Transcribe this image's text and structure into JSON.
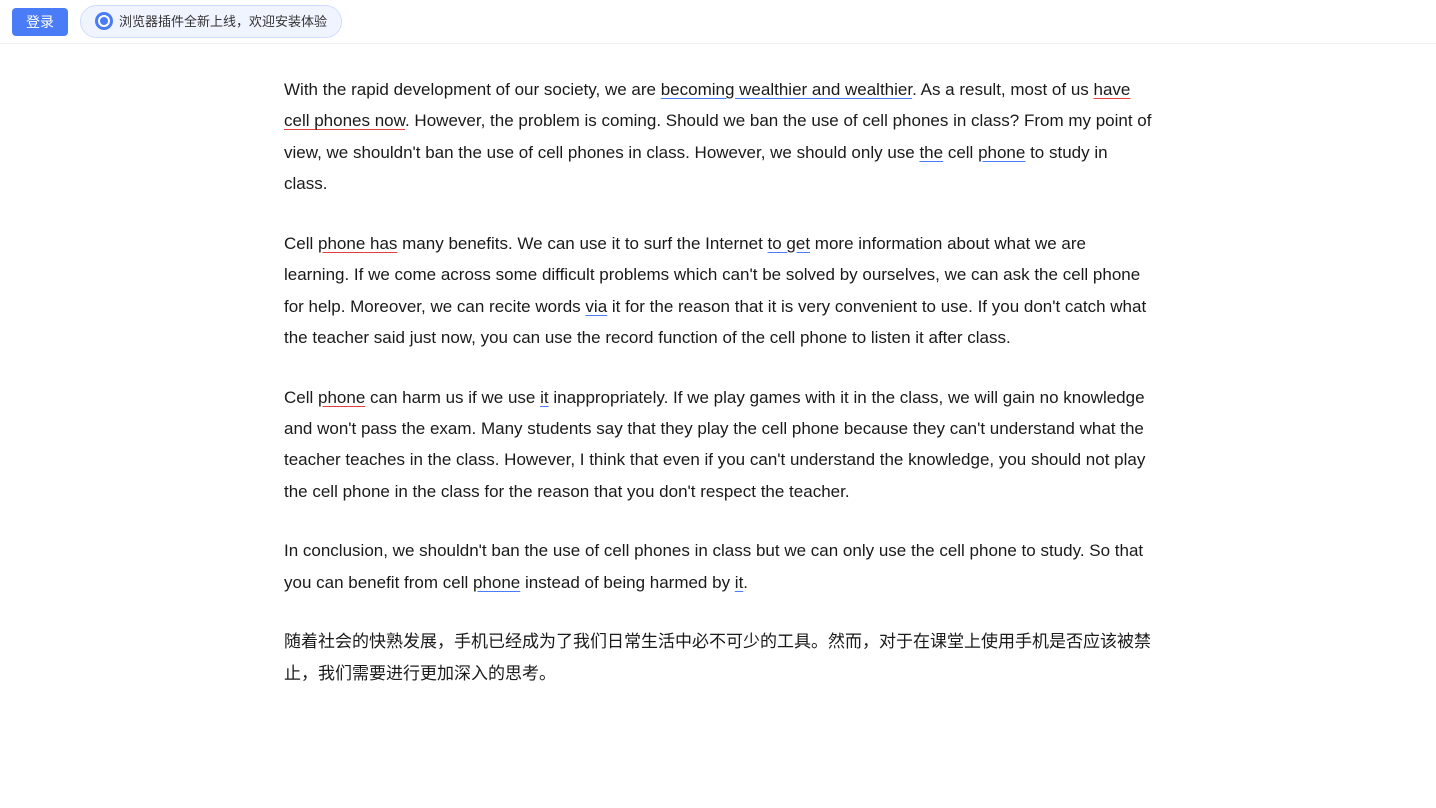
{
  "topbar": {
    "login_label": "登录",
    "banner_text": "浏览器插件全新上线，欢迎安装体验"
  },
  "article": {
    "paragraphs": [
      {
        "id": "p1",
        "text": "With the rapid development of our society, we are becoming wealthier and wealthier. As a result, most of us have cell phones now. However, the problem is coming. Should we ban the use of cell phones in class? From my point of view, we shouldn't ban the use of cell phones in class. However, we should only use the cell phone to study in class."
      },
      {
        "id": "p2",
        "text": "Cell phone has many benefits. We can use it to surf the Internet to get more information about what we are learning. If we come across some difficult problems which can't be solved by ourselves, we can ask the cell phone for help. Moreover, we can recite words via it for the reason that it is very convenient to use. If you don't catch what the teacher said just now, you can use the record function of the cell phone to listen it after class."
      },
      {
        "id": "p3",
        "text": "Cell phone can harm us if we use it inappropriately. If we play games with it in the class, we will gain no knowledge and won't pass the exam. Many students say that they play the cell phone because they can't understand what the teacher teaches in the class. However, I think that even if you can't understand the knowledge, you should not play the cell phone in the class for the reason that you don't respect the teacher."
      },
      {
        "id": "p4",
        "text": "In conclusion, we shouldn't ban the use of cell phones in class but we can only use the cell phone to study. So that you can benefit from cell phone instead of being harmed by it."
      },
      {
        "id": "p5_chinese",
        "text": "随着社会的快熟发展，手机已经成为了我们日常生活中必不可少的工具。然而，对于在课堂上使用手机是否应该被禁止，我们需要进行更加深入的思考。"
      }
    ]
  }
}
